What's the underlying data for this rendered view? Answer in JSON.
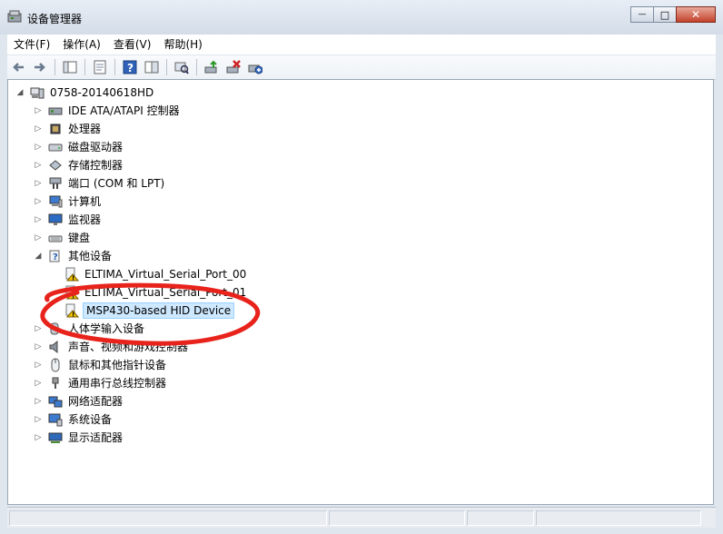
{
  "window": {
    "title": "设备管理器"
  },
  "window_controls": {
    "minimize": "—",
    "maximize": "□",
    "close": "✕"
  },
  "menu": [
    "文件(F)",
    "操作(A)",
    "查看(V)",
    "帮助(H)"
  ],
  "tree": {
    "root": "0758-20140618HD",
    "items": [
      {
        "label": "IDE ATA/ATAPI 控制器",
        "icon": "ide-controller-icon"
      },
      {
        "label": "处理器",
        "icon": "processor-icon"
      },
      {
        "label": "磁盘驱动器",
        "icon": "disk-drive-icon"
      },
      {
        "label": "存储控制器",
        "icon": "storage-controller-icon"
      },
      {
        "label": "端口 (COM 和 LPT)",
        "icon": "port-icon"
      },
      {
        "label": "计算机",
        "icon": "computer-icon"
      },
      {
        "label": "监视器",
        "icon": "monitor-icon"
      },
      {
        "label": "键盘",
        "icon": "keyboard-icon"
      },
      {
        "label": "其他设备",
        "icon": "other-devices-icon",
        "expanded": true,
        "children": [
          {
            "label": "ELTIMA_Virtual_Serial_Port_00",
            "icon": "warning-device-icon"
          },
          {
            "label": "ELTIMA_Virtual_Serial_Port_01",
            "icon": "warning-device-icon"
          },
          {
            "label": "MSP430-based HID Device",
            "icon": "warning-device-icon",
            "selected": true
          }
        ]
      },
      {
        "label": "人体学输入设备",
        "icon": "hid-icon"
      },
      {
        "label": "声音、视频和游戏控制器",
        "icon": "sound-icon"
      },
      {
        "label": "鼠标和其他指针设备",
        "icon": "mouse-icon"
      },
      {
        "label": "通用串行总线控制器",
        "icon": "usb-icon"
      },
      {
        "label": "网络适配器",
        "icon": "network-adapter-icon"
      },
      {
        "label": "系统设备",
        "icon": "system-devices-icon"
      },
      {
        "label": "显示适配器",
        "icon": "display-adapter-icon"
      }
    ]
  },
  "annotation": {
    "color": "#e8231c"
  }
}
